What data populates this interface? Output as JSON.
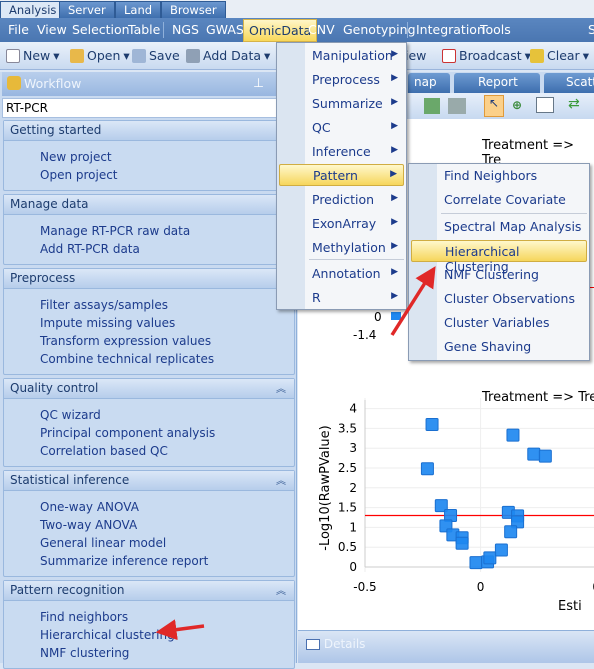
{
  "top_tabs": [
    "Analysis",
    "Server",
    "Land",
    "Browser"
  ],
  "menubar": [
    "File",
    "View",
    "Selection",
    "Table",
    "NGS",
    "GWAS",
    "OmicData",
    "CNV",
    "Genotyping",
    "Integration",
    "Tools",
    "S"
  ],
  "toolbar": {
    "new": "New",
    "open": "Open",
    "save": "Save",
    "add_data": "Add Data",
    "view_partial": "iew",
    "broadcast": "Broadcast",
    "clear": "Clear"
  },
  "workflow": {
    "title": "Workflow",
    "input_value": "RT-PCR",
    "sections": [
      {
        "title": "Getting started",
        "items": [
          "New project",
          "Open project"
        ]
      },
      {
        "title": "Manage data",
        "items": [
          "Manage RT-PCR raw data",
          "Add RT-PCR data"
        ]
      },
      {
        "title": "Preprocess",
        "items": [
          "Filter assays/samples",
          "Impute missing values",
          "Transform expression values",
          "Combine technical replicates"
        ]
      },
      {
        "title": "Quality control",
        "items": [
          "QC wizard",
          "Principal component analysis",
          "Correlation based QC"
        ]
      },
      {
        "title": "Statistical inference",
        "items": [
          "One-way ANOVA",
          "Two-way ANOVA",
          "General linear model",
          "Summarize inference report"
        ]
      },
      {
        "title": "Pattern recognition",
        "items": [
          "Find neighbors",
          "Hierarchical clustering",
          "NMF clustering"
        ]
      }
    ]
  },
  "doc_tabs": [
    "nap",
    "Report",
    "Scatt"
  ],
  "omicdata_menu": [
    "Manipulation",
    "Preprocess",
    "Summarize",
    "QC",
    "Inference",
    "Pattern",
    "Prediction",
    "ExonArray",
    "Methylation",
    "Annotation",
    "R"
  ],
  "pattern_submenu": [
    "Find Neighbors",
    "Correlate Covariate",
    "Spectral Map Analysis",
    "Hierarchical Clustering",
    "NMF Clustering",
    "Cluster Observations",
    "Cluster Variables",
    "Gene Shaving"
  ],
  "top_chart": {
    "title": "Treatment => Tre",
    "y_tick": "0",
    "x_tick": "-1.4"
  },
  "chart_data": {
    "type": "scatter",
    "title": "Treatment => Tre",
    "xlabel": "Esti",
    "ylabel": "-Log10(RawPValue)",
    "xlim": [
      -0.5,
      0.6
    ],
    "ylim": [
      0,
      4
    ],
    "x_ticks": [
      "-0.5",
      "0",
      "0"
    ],
    "y_ticks": [
      "0",
      "0.5",
      "1",
      "1.5",
      "2",
      "2.5",
      "3",
      "3.5",
      "4"
    ],
    "threshold_y": 1.3,
    "marker_color": "#1e88f0",
    "threshold_color": "#ff0000",
    "grid": true,
    "points": [
      [
        -0.21,
        3.6
      ],
      [
        -0.23,
        2.48
      ],
      [
        0.14,
        3.33
      ],
      [
        0.23,
        2.85
      ],
      [
        0.28,
        2.8
      ],
      [
        -0.17,
        1.55
      ],
      [
        -0.13,
        1.3
      ],
      [
        -0.15,
        1.04
      ],
      [
        -0.12,
        0.81
      ],
      [
        -0.08,
        0.74
      ],
      [
        -0.08,
        0.6
      ],
      [
        -0.02,
        0.11
      ],
      [
        0.03,
        0.13
      ],
      [
        0.04,
        0.23
      ],
      [
        0.09,
        0.43
      ],
      [
        0.12,
        1.38
      ],
      [
        0.16,
        1.29
      ],
      [
        0.16,
        1.14
      ],
      [
        0.13,
        0.89
      ]
    ]
  },
  "details": "Details"
}
